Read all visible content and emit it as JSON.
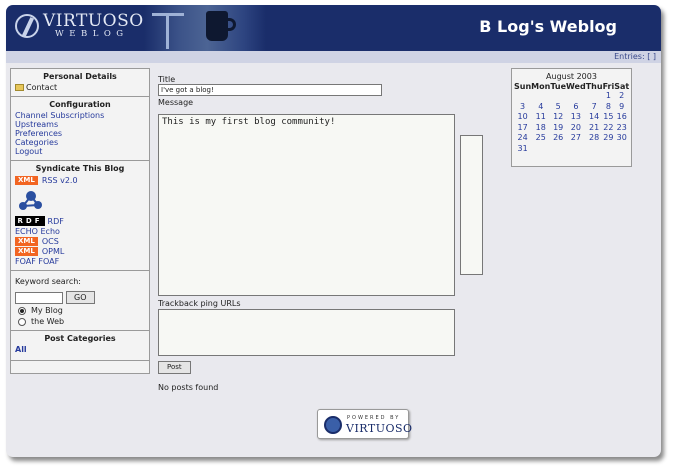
{
  "header": {
    "logo_main": "VIRTUOSO",
    "logo_sub": "WEBLOG",
    "title": "B Log's Weblog"
  },
  "subbar": {
    "entries": "Entries: [ ]"
  },
  "sidebar": {
    "personal": {
      "heading": "Personal Details",
      "contact": "Contact"
    },
    "configuration": {
      "heading": "Configuration",
      "items": [
        "Channel Subscriptions",
        "Upstreams",
        "Preferences",
        "Categories",
        "Logout"
      ]
    },
    "syndicate": {
      "heading": "Syndicate This Blog",
      "xml_badge": "XML",
      "rss": "RSS v2.0",
      "rdf_badge": "RDF",
      "rdf": "RDF",
      "echo": "ECHO Echo",
      "ocs": "OCS",
      "opml": "OPML",
      "foaf": "FOAF FOAF"
    },
    "search": {
      "label": "Keyword search:",
      "go": "GO",
      "input_value": "",
      "option_blog": "My Blog",
      "option_web": "the Web"
    },
    "post_categories": {
      "heading": "Post Categories",
      "all": "All"
    }
  },
  "form": {
    "title_label": "Title",
    "title_value": "I've got a blog!",
    "message_label": "Message",
    "message_value": "This is my first blog community!",
    "trackback_label": "Trackback ping URLs",
    "post_button": "Post",
    "no_posts": "No posts found"
  },
  "powered": {
    "top": "POWERED BY",
    "name": "VIRTUOSO"
  },
  "calendar": {
    "title": "August 2003",
    "days": [
      "Sun",
      "Mon",
      "Tue",
      "Wed",
      "Thu",
      "Fri",
      "Sat"
    ],
    "weeks": [
      [
        "",
        "",
        "",
        "",
        "",
        "1",
        "2"
      ],
      [
        "3",
        "4",
        "5",
        "6",
        "7",
        "8",
        "9"
      ],
      [
        "10",
        "11",
        "12",
        "13",
        "14",
        "15",
        "16"
      ],
      [
        "17",
        "18",
        "19",
        "20",
        "21",
        "22",
        "23"
      ],
      [
        "24",
        "25",
        "26",
        "27",
        "28",
        "29",
        "30"
      ],
      [
        "31",
        "",
        "",
        "",
        "",
        "",
        ""
      ]
    ]
  },
  "colors": {
    "header_bg": "#1a2d6a",
    "link": "#263a9c",
    "xml_badge": "#f26522",
    "page_bg": "#e9e9ee"
  }
}
